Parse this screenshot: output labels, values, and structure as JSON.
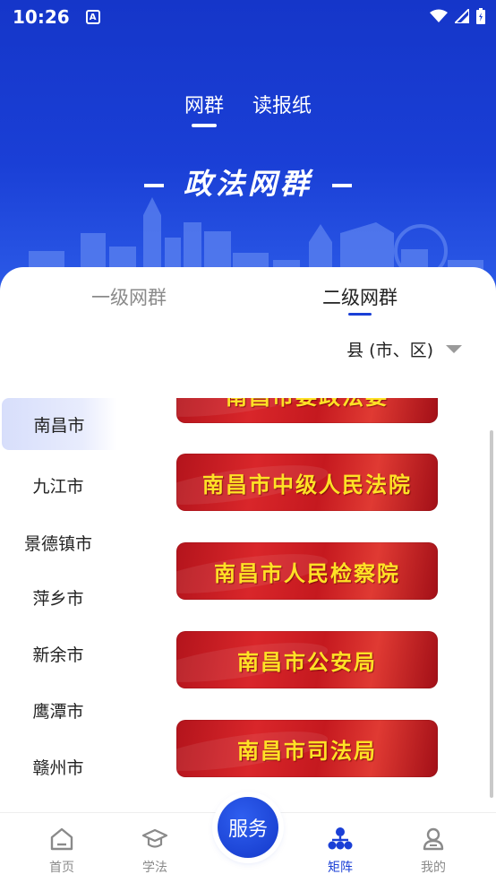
{
  "status_bar": {
    "time": "10:26",
    "notif_letter": "A"
  },
  "top_tabs": [
    {
      "label": "网群",
      "active": true
    },
    {
      "label": "读报纸",
      "active": false
    }
  ],
  "banner": {
    "title": "政法网群"
  },
  "level_tabs": [
    {
      "label": "一级网群",
      "active": false
    },
    {
      "label": "二级网群",
      "active": true
    }
  ],
  "county_select": {
    "label": "县 (市、区)"
  },
  "cities": [
    {
      "label": "南昌市",
      "active": true
    },
    {
      "label": "九江市"
    },
    {
      "label": "景德镇市"
    },
    {
      "label": "萍乡市"
    },
    {
      "label": "新余市"
    },
    {
      "label": "鹰潭市"
    },
    {
      "label": "赣州市"
    }
  ],
  "org_cards": [
    {
      "label": "南昌市委政法委"
    },
    {
      "label": "南昌市中级人民法院"
    },
    {
      "label": "南昌市人民检察院"
    },
    {
      "label": "南昌市公安局"
    },
    {
      "label": "南昌市司法局"
    }
  ],
  "bottom_nav": {
    "home": "首页",
    "learn": "学法",
    "service": "服务",
    "matrix": "矩阵",
    "mine": "我的"
  },
  "colors": {
    "primary": "#1a3fd6",
    "card_red": "#d9262a",
    "card_text": "#ffe126"
  }
}
